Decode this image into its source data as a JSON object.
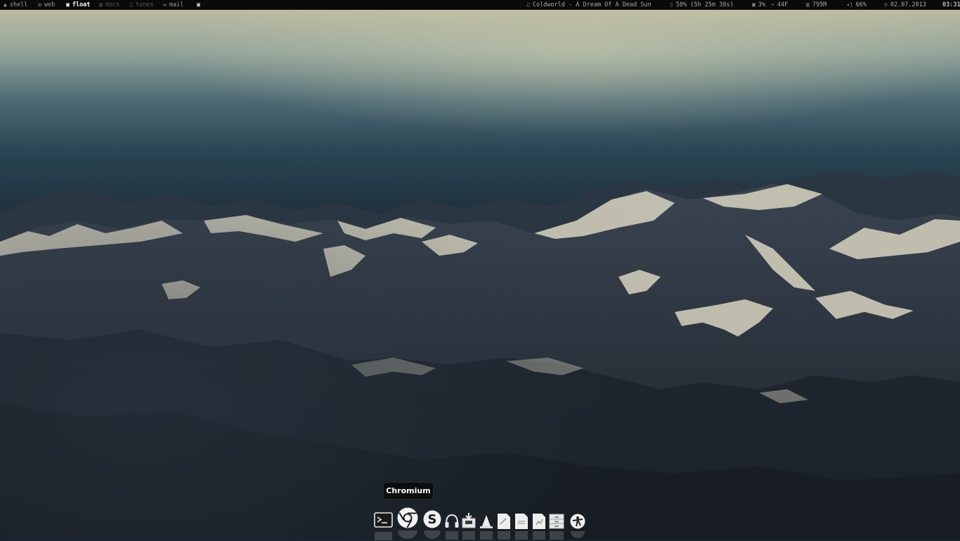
{
  "topbar": {
    "workspaces": [
      {
        "name": "shell",
        "icon": "arch-logo-icon",
        "state": "normal"
      },
      {
        "name": "web",
        "icon": "globe-icon",
        "state": "normal"
      },
      {
        "name": "float",
        "icon": "window-icon",
        "state": "active"
      },
      {
        "name": "docs",
        "icon": "document-icon",
        "state": "inactive"
      },
      {
        "name": "tunes",
        "icon": "music-note-icon",
        "state": "inactive"
      },
      {
        "name": "mail",
        "icon": "envelope-icon",
        "state": "normal"
      }
    ],
    "now_playing": "Coldworld - A Dream Of A Dead Sun",
    "battery": "58% (5h 25m 38s)",
    "cpu": "3%",
    "temperature": "44F",
    "memory": "795M",
    "volume": "66%",
    "date": "02.07.2013",
    "time": "03:31"
  },
  "dock": {
    "tooltip": "Chromium",
    "items": [
      {
        "name": "terminal",
        "icon": "terminal-icon"
      },
      {
        "name": "chromium",
        "icon": "chromium-icon"
      },
      {
        "name": "skype",
        "icon": "skype-icon"
      },
      {
        "name": "music-player",
        "icon": "headphones-icon"
      },
      {
        "name": "package-manager",
        "icon": "package-icon"
      },
      {
        "name": "vlc",
        "icon": "traffic-cone-icon"
      },
      {
        "name": "text-editor",
        "icon": "text-document-icon"
      },
      {
        "name": "document-viewer",
        "icon": "document-icon"
      },
      {
        "name": "spreadsheet",
        "icon": "spreadsheet-icon"
      },
      {
        "name": "file-manager",
        "icon": "file-cabinet-icon"
      },
      {
        "name": "system-settings",
        "icon": "settings-icon"
      }
    ]
  },
  "colors": {
    "panel_bg": "#0a0a0a",
    "panel_text": "#9a9a9a",
    "panel_active": "#ffffff",
    "panel_inactive": "#5a5a5a"
  }
}
